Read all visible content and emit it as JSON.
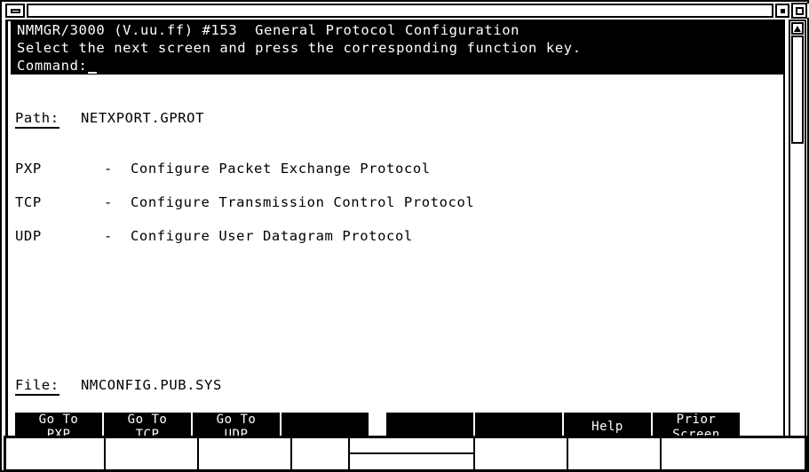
{
  "window": {
    "title": "",
    "menu_button_icon": "window-menu-icon",
    "minimize_icon": "minimize-icon",
    "maximize_icon": "maximize-icon"
  },
  "terminal": {
    "header": {
      "line1": "NMMGR/3000 (V.uu.ff) #153  General Protocol Configuration",
      "line2": "Select the next screen and press the corresponding function key.",
      "line3": "Command:"
    },
    "path": {
      "label": "Path:",
      "value": "NETXPORT.GPROT"
    },
    "menu_items": [
      {
        "code": "PXP",
        "dash": "-",
        "description": "Configure Packet Exchange Protocol"
      },
      {
        "code": "TCP",
        "dash": "-",
        "description": "Configure Transmission Control Protocol"
      },
      {
        "code": "UDP",
        "dash": "-",
        "description": "Configure User Datagram Protocol"
      }
    ],
    "file": {
      "label": "File:",
      "value": "NMCONFIG.PUB.SYS"
    },
    "function_keys": [
      {
        "line1": "Go To",
        "line2": "PXP"
      },
      {
        "line1": "Go To",
        "line2": "TCP"
      },
      {
        "line1": "Go To",
        "line2": "UDP"
      },
      {
        "line1": "",
        "line2": ""
      },
      {
        "line1": "",
        "line2": ""
      },
      {
        "line1": "",
        "line2": ""
      },
      {
        "line1": "Help",
        "line2": ""
      },
      {
        "line1": "Prior",
        "line2": "Screen"
      }
    ]
  },
  "scrollbar": {
    "up_icon": "scroll-up-arrow-icon",
    "down_icon": "scroll-down-arrow-icon",
    "thumb_position_percent": 0,
    "thumb_size_percent": 27
  },
  "status_bar": {
    "cells": [
      "",
      "",
      "",
      "",
      "",
      "",
      "",
      ""
    ]
  },
  "colors": {
    "foreground": "#000000",
    "background": "#ffffff",
    "inverse_text": "#ffffff",
    "inverse_background": "#000000"
  }
}
